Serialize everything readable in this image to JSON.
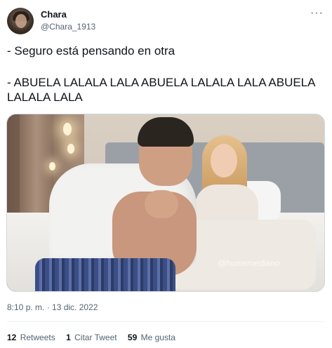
{
  "author": {
    "display_name": "Chara",
    "handle": "@Chara_1913"
  },
  "tweet": {
    "line1": "- Seguro está pensando en otra",
    "line2": "- ABUELA LALALA LALA ABUELA LALALA LALA ABUELA LALALA LALA"
  },
  "media": {
    "watermark": "@humemediano"
  },
  "timestamp": "8:10 p. m. · 13 dic. 2022",
  "stats": {
    "retweets_count": "12",
    "retweets_label": "Retweets",
    "quotes_count": "1",
    "quotes_label": "Citar Tweet",
    "likes_count": "59",
    "likes_label": "Me gusta"
  },
  "icons": {
    "more": "more-icon"
  },
  "colors": {
    "text": "#0f1419",
    "secondary": "#536471",
    "divider": "#eff3f4"
  }
}
